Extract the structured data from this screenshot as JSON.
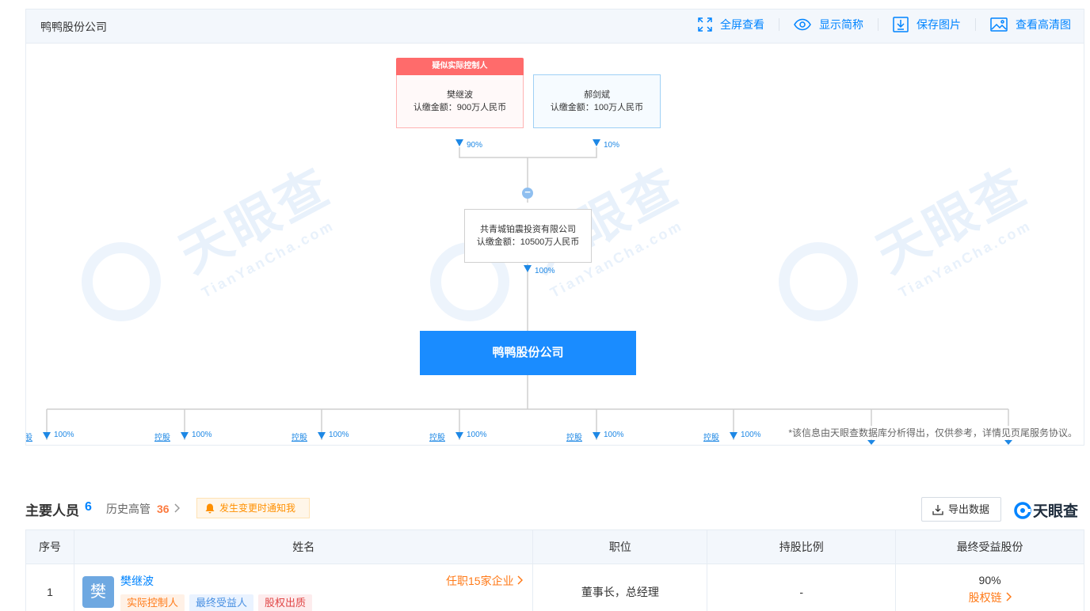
{
  "panel": {
    "title": "鸭鸭股份公司",
    "tools": [
      "全屏查看",
      "显示简称",
      "保存图片",
      "查看高清图"
    ]
  },
  "watermark": {
    "brand": "天眼查",
    "domain": "TianYanCha.com"
  },
  "equity": {
    "shareholders": [
      {
        "badge": "疑似实际控制人",
        "name": "樊继波",
        "amount": "认缴金额：900万人民币",
        "pct": "90%"
      },
      {
        "name": "郝剑斌",
        "amount": "认缴金额：100万人民币",
        "pct": "10%"
      }
    ],
    "parent": {
      "name": "共青城铂震投资有限公司",
      "amount": "认缴金额：10500万人民币",
      "pct": "100%"
    },
    "main_company": "鸭鸭股份公司",
    "collapse_symbol": "−",
    "subsidiaries": [
      {
        "tag": "控股",
        "pct": "100%"
      },
      {
        "tag": "控股",
        "pct": "100%"
      },
      {
        "tag": "控股",
        "pct": "100%"
      },
      {
        "tag": "控股",
        "pct": "100%"
      },
      {
        "tag": "控股",
        "pct": "100%"
      },
      {
        "tag": "控股",
        "pct": "100%"
      }
    ],
    "disclaimer": "*该信息由天眼查数据库分析得出，仅供参考，详情见页尾服务协议。"
  },
  "people": {
    "title": "主要人员",
    "count": "6",
    "history_label": "历史高管",
    "history_count": "36",
    "notify_label": "发生变更时通知我",
    "export_label": "导出数据",
    "logo_text": "天眼查",
    "columns": [
      "序号",
      "姓名",
      "职位",
      "持股比例",
      "最终受益股份"
    ],
    "rows": [
      {
        "index": "1",
        "avatar_char": "樊",
        "name": "樊继波",
        "jobs": "任职15家企业",
        "tags": [
          "实际控制人",
          "最终受益人",
          "股权出质"
        ],
        "position": "董事长，总经理",
        "holding": "-",
        "ubo": "90%",
        "ubo_link": "股权链"
      }
    ]
  },
  "colors": {
    "accent": "#0084ff",
    "main_box": "#1a8cff",
    "badge": "#ff6b6b",
    "orange": "#ff7a18"
  }
}
